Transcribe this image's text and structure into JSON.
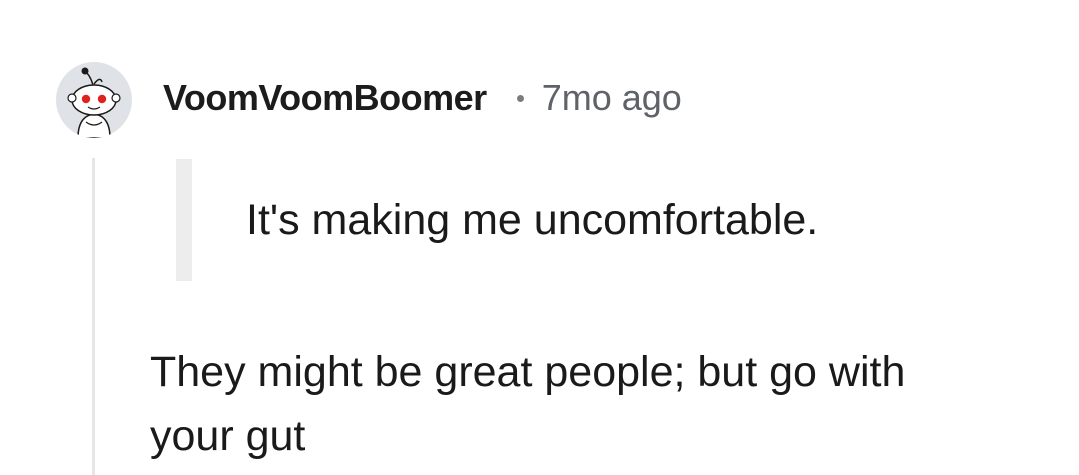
{
  "comment": {
    "author": "VoomVoomBoomer",
    "timestamp": "7mo ago",
    "quote": "It's making me uncomfortable.",
    "body_line1": "They might be great people; but go with",
    "body_line2": "your gut"
  },
  "icons": {
    "avatar": "reddit-snoo-avatar-icon",
    "separator": "dot-separator-icon"
  },
  "colors": {
    "avatar_bg": "#dfe3e7",
    "avatar_eyes": "#e0221e",
    "timestamp": "#5f6368",
    "thread_line": "#e6e6e6",
    "quote_bar": "#ededed"
  }
}
